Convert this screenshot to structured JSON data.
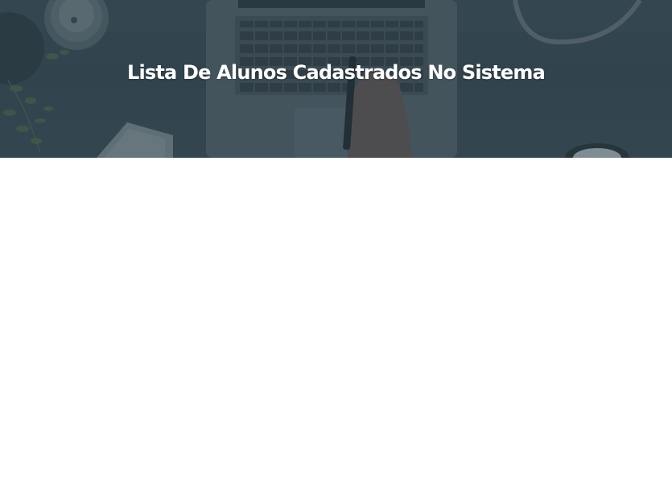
{
  "hero": {
    "title": "Lista De Alunos Cadastrados No Sistema"
  },
  "colors": {
    "hero_background": "#34444c",
    "hero_overlay": "#2a3e4a",
    "title_text": "#ffffff",
    "page_background": "#ffffff"
  }
}
